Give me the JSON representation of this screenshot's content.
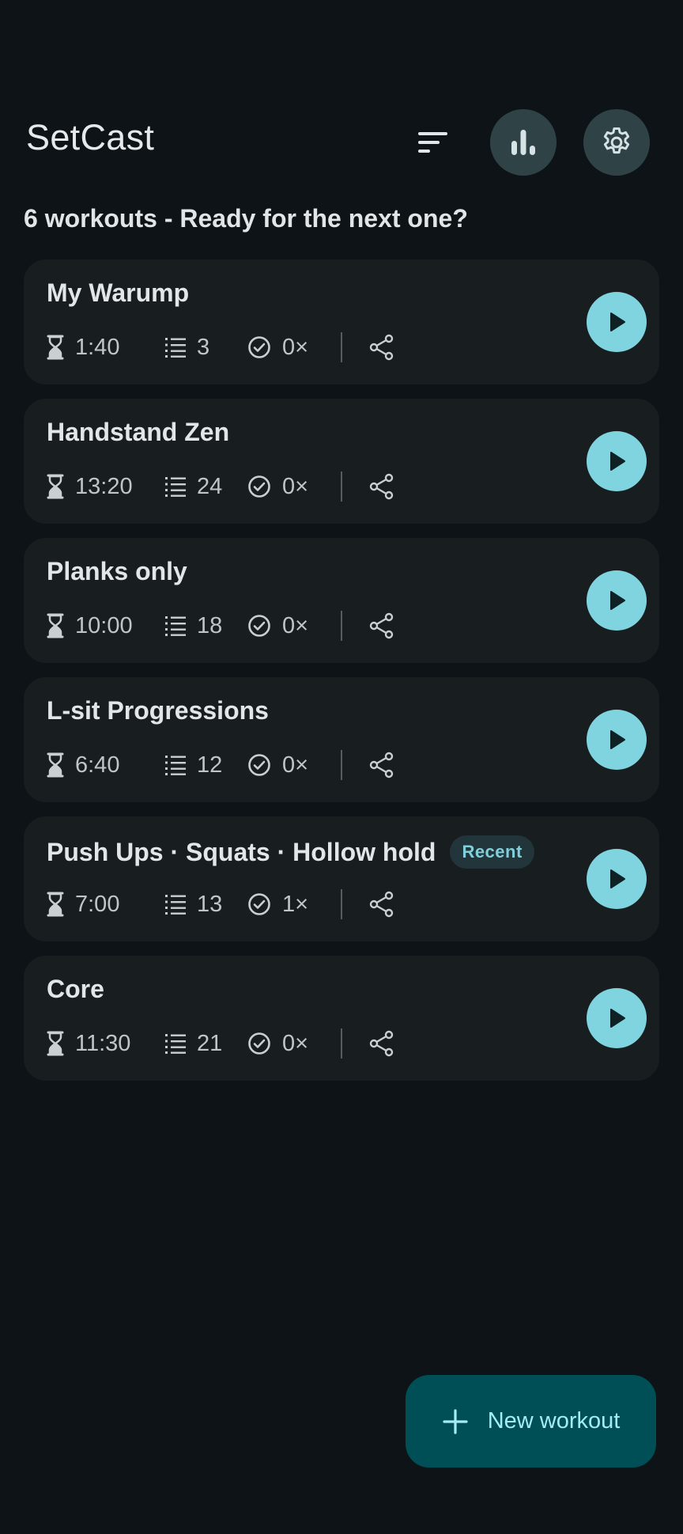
{
  "header": {
    "title": "SetCast",
    "sort_icon": "sort-icon",
    "stats_icon": "bar-chart-icon",
    "settings_icon": "gear-icon"
  },
  "summary": "6 workouts - Ready for the next one?",
  "workouts": [
    {
      "name": "My Warump",
      "duration": "1:40",
      "steps": "3",
      "completed": "0×",
      "badge": ""
    },
    {
      "name": "Handstand Zen",
      "duration": "13:20",
      "steps": "24",
      "completed": "0×",
      "badge": ""
    },
    {
      "name": "Planks only",
      "duration": "10:00",
      "steps": "18",
      "completed": "0×",
      "badge": ""
    },
    {
      "name": "L-sit Progressions",
      "duration": "6:40",
      "steps": "12",
      "completed": "0×",
      "badge": ""
    },
    {
      "name": "Push Ups · Squats · Hollow hold",
      "duration": "7:00",
      "steps": "13",
      "completed": "1×",
      "badge": "Recent"
    },
    {
      "name": "Core",
      "duration": "11:30",
      "steps": "21",
      "completed": "0×",
      "badge": ""
    }
  ],
  "fab": {
    "label": "New workout",
    "icon": "plus-icon"
  },
  "colors": {
    "background": "#0d1316",
    "card": "#181d20",
    "accent": "#7fd4df",
    "fab": "#004f56",
    "round_button": "#2f4347"
  }
}
